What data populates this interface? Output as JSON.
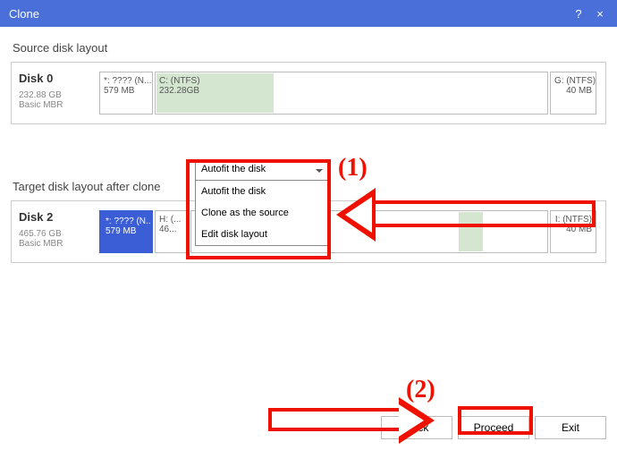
{
  "window": {
    "title": "Clone",
    "help_icon": "?",
    "close_icon": "×"
  },
  "source": {
    "section_title": "Source disk layout",
    "disk_name": "Disk 0",
    "disk_size": "232.88 GB",
    "disk_type": "Basic MBR",
    "parts": [
      {
        "label": "*: ???? (N...",
        "size": "579 MB"
      },
      {
        "label": "C: (NTFS)",
        "size": "232.28GB"
      },
      {
        "label": "G: (NTFS)",
        "size": "40 MB"
      }
    ]
  },
  "target": {
    "section_title": "Target disk layout after clone",
    "disk_name": "Disk 2",
    "disk_size": "465.76 GB",
    "disk_type": "Basic MBR",
    "parts": [
      {
        "label": "*: ???? (N...",
        "size": "579 MB"
      },
      {
        "label": "H: (...",
        "size": "46..."
      },
      {
        "label": "I: (NTFS)",
        "size": "40 MB"
      }
    ]
  },
  "dropdown": {
    "selected": "Autofit the disk",
    "options": [
      "Autofit the disk",
      "Clone as the source",
      "Edit disk layout"
    ]
  },
  "buttons": {
    "back": "Back",
    "proceed": "Proceed",
    "exit": "Exit"
  },
  "annotations": {
    "step1": "(1)",
    "step2": "(2)"
  }
}
